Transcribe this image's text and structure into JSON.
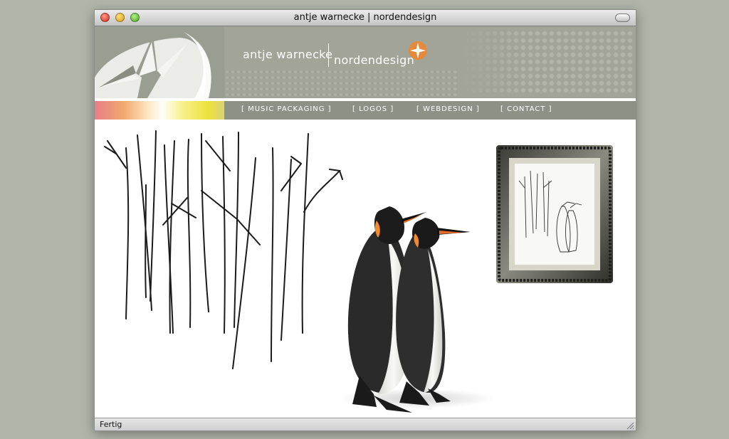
{
  "window": {
    "title": "antje warnecke | nordendesign"
  },
  "header": {
    "brand_name": "antje warnecke",
    "brand_design": "nordendesign"
  },
  "nav": {
    "items": [
      {
        "label": "[  MUSIC PACKAGING  ]"
      },
      {
        "label": "[  LOGOS  ]"
      },
      {
        "label": "[  WEBDESIGN  ]"
      },
      {
        "label": "[  CONTACT  ]"
      }
    ]
  },
  "status": {
    "text": "Fertig"
  },
  "colors": {
    "desktop": "#b1b6aa",
    "header_gray": "#a2a498",
    "logo_gray": "#9a9d91",
    "nav_gray": "#8e9186",
    "accent_orange": "#e58a3c"
  },
  "icons": [
    "bird-logo-icon",
    "orange-star-icon",
    "resize-grip-icon"
  ]
}
